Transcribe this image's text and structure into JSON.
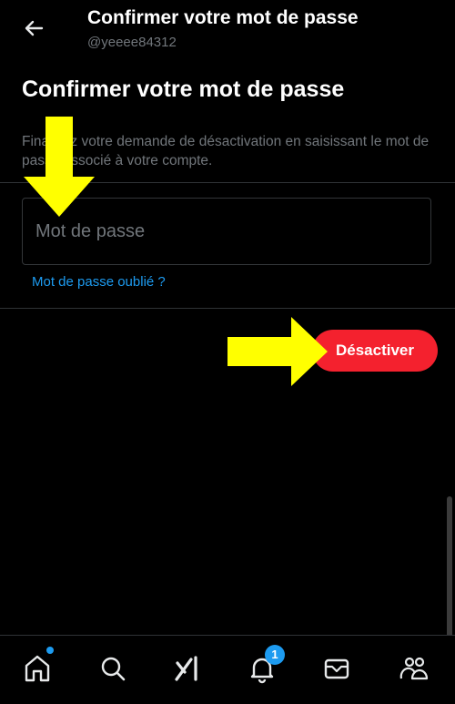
{
  "header": {
    "title": "Confirmer votre mot de passe",
    "username": "@yeeee84312"
  },
  "main": {
    "title": "Confirmer votre mot de passe",
    "description": "Finalisez votre demande de désactivation en saisissant le mot de passe associé à votre compte.",
    "password_placeholder": "Mot de passe",
    "password_value": "",
    "forgot_link": "Mot de passe oublié ?",
    "deactivate_label": "Désactiver"
  },
  "nav": {
    "items": [
      "home-icon",
      "search-icon",
      "grok-icon",
      "notifications-icon",
      "messages-icon",
      "communities-icon"
    ],
    "notification_count": "1"
  },
  "colors": {
    "background": "#000000",
    "accent": "#1d9bf0",
    "danger": "#f4212e",
    "annotation_arrow": "#ffff00"
  }
}
